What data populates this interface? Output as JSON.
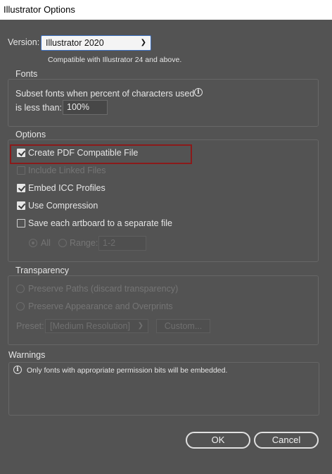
{
  "window": {
    "title": "Illustrator Options"
  },
  "version": {
    "label": "Version:",
    "selected": "Illustrator 2020",
    "note": "Compatible with Illustrator 24 and above."
  },
  "fonts": {
    "title": "Fonts",
    "line1": "Subset fonts when percent of characters used",
    "line2": "is less than:",
    "percent": "100%"
  },
  "options": {
    "title": "Options",
    "create_pdf": "Create PDF Compatible File",
    "include_linked": "Include Linked Files",
    "embed_icc": "Embed ICC Profiles",
    "use_compression": "Use Compression",
    "save_artboards": "Save each artboard to a separate file",
    "radio_all": "All",
    "radio_range": "Range:",
    "range_value": "1-2"
  },
  "transparency": {
    "title": "Transparency",
    "preserve_paths": "Preserve Paths (discard transparency)",
    "preserve_appearance": "Preserve Appearance and Overprints",
    "preset_label": "Preset:",
    "preset_value": "[Medium Resolution]",
    "custom_button": "Custom..."
  },
  "warnings": {
    "title": "Warnings",
    "message": "Only fonts with appropriate permission bits will be embedded."
  },
  "buttons": {
    "ok": "OK",
    "cancel": "Cancel"
  },
  "colors": {
    "highlight": "#8b1a1a",
    "background": "#535353"
  },
  "icons": {
    "info": "info-circle-icon",
    "dropdown": "chevron-down-icon"
  },
  "state": {
    "create_pdf_checked": true,
    "include_linked_checked": false,
    "embed_icc_checked": true,
    "use_compression_checked": true,
    "save_artboards_checked": false
  }
}
